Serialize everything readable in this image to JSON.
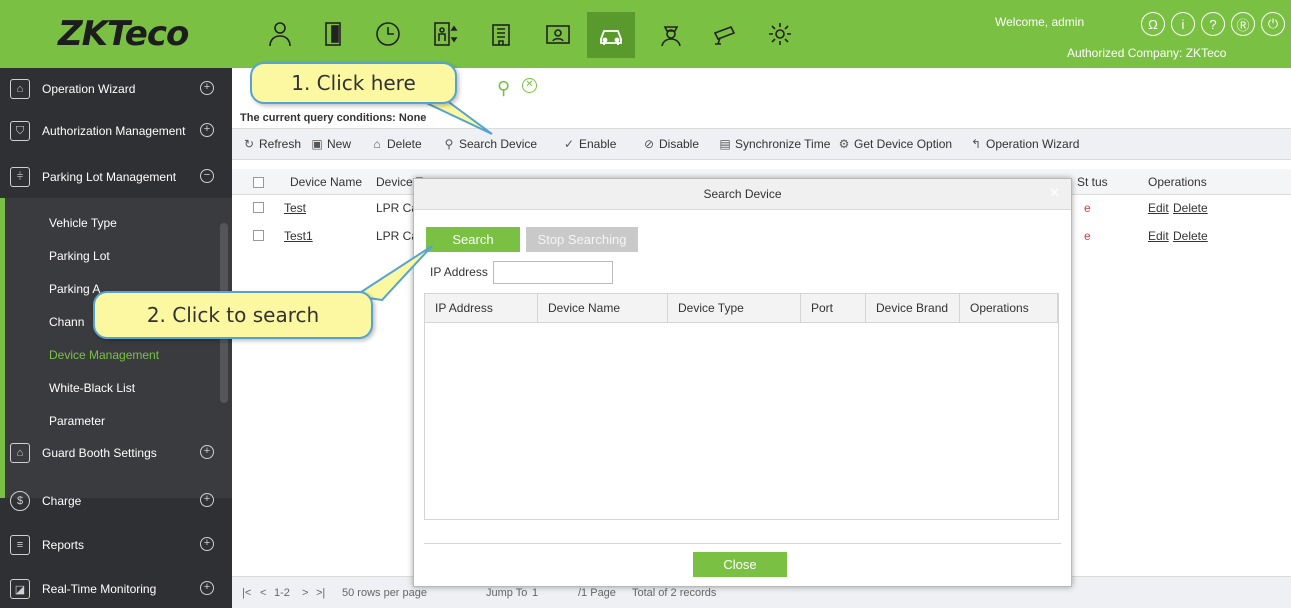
{
  "header": {
    "logo": "ZKTeco",
    "welcome": "Welcome, admin",
    "company": "Authorized Company: ZKTeco",
    "module_icons": [
      "personnel-icon",
      "door-icon",
      "clock-icon",
      "elevator-icon",
      "building-icon",
      "visitor-icon",
      "car-icon",
      "guard-icon",
      "camera-icon",
      "settings-icon"
    ],
    "right_icons": [
      "user-icon",
      "info-icon",
      "help-icon",
      "profile-icon",
      "power-icon"
    ],
    "accent_color": "#7ac143"
  },
  "sidebar": {
    "groups_top": [
      {
        "label": "Operation Wizard",
        "icon": "wizard-icon"
      },
      {
        "label": "Authorization Management",
        "icon": "shield-icon"
      },
      {
        "label": "Parking Lot Management",
        "icon": "sliders-icon"
      }
    ],
    "sub_items": [
      {
        "label": "Vehicle Type",
        "active": false
      },
      {
        "label": "Parking Lot",
        "active": false
      },
      {
        "label": "Parking A",
        "active": false
      },
      {
        "label": "Chann",
        "active": false
      },
      {
        "label": "Device Management",
        "active": true
      },
      {
        "label": "White-Black List",
        "active": false
      },
      {
        "label": "Parameter",
        "active": false
      }
    ],
    "groups_bottom": [
      {
        "label": "Guard Booth Settings",
        "icon": "booth-icon"
      },
      {
        "label": "Charge",
        "icon": "coin-icon"
      },
      {
        "label": "Reports",
        "icon": "report-icon"
      },
      {
        "label": "Real-Time Monitoring",
        "icon": "monitor-icon"
      }
    ]
  },
  "main": {
    "query_conditions": "The current query conditions: None",
    "toolbar": {
      "refresh": "Refresh",
      "new": "New",
      "delete": "Delete",
      "search_device": "Search Device",
      "enable": "Enable",
      "disable": "Disable",
      "sync_time": "Synchronize Time",
      "get_option": "Get Device Option",
      "wizard": "Operation Wizard"
    },
    "table": {
      "headers": {
        "device_name": "Device Name",
        "device_type": "Device T",
        "status": "St  tus",
        "operations": "Operations"
      },
      "rows": [
        {
          "name": "Test",
          "type": "LPR Ca",
          "status": "e",
          "edit": "Edit",
          "delete": "Delete"
        },
        {
          "name": "Test1",
          "type": "LPR Ca",
          "status": "e",
          "edit": "Edit",
          "delete": "Delete"
        }
      ]
    },
    "pager": {
      "range": "1-2",
      "per_page": "50 rows per page",
      "jump_to": "Jump To",
      "page_value": "1",
      "page_total": "/1 Page",
      "total": "Total of 2 records"
    }
  },
  "modal": {
    "title": "Search Device",
    "search_button": "Search",
    "stop_button": "Stop Searching",
    "ip_label": "IP Address",
    "ip_value": "",
    "columns": [
      "IP Address",
      "Device Name",
      "Device Type",
      "Port",
      "Device Brand",
      "Operations"
    ],
    "close_button": "Close"
  },
  "callouts": {
    "step1": "1. Click here",
    "step2": "2. Click to search"
  }
}
